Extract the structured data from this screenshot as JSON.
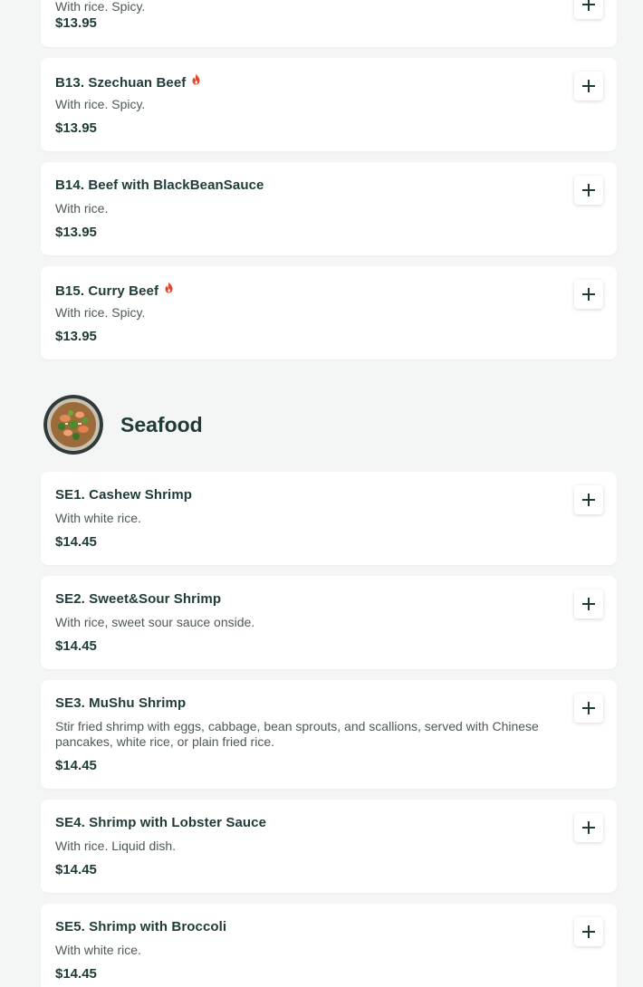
{
  "accent_color": "#1f3b38",
  "spicy_color": "#e0442b",
  "top_partial": {
    "description": "With rice. Spicy.",
    "price": "$13.95"
  },
  "beef_items": [
    {
      "title": "B13. Szechuan Beef",
      "spicy": true,
      "description": "With rice. Spicy.",
      "price": "$13.95"
    },
    {
      "title": "B14. Beef with BlackBeanSauce",
      "spicy": false,
      "description": "With rice.",
      "price": "$13.95"
    },
    {
      "title": "B15. Curry Beef",
      "spicy": true,
      "description": "With rice. Spicy.",
      "price": "$13.95"
    }
  ],
  "seafood": {
    "title": "Seafood",
    "image": "seafood-dish-photo",
    "items": [
      {
        "title": "SE1. Cashew Shrimp",
        "description": "With white rice.",
        "price": "$14.45"
      },
      {
        "title": "SE2. Sweet&Sour Shrimp",
        "description": "With rice, sweet sour sauce onside.",
        "price": "$14.45"
      },
      {
        "title": "SE3. MuShu Shrimp",
        "description": "Stir fried shrimp with eggs, cabbage, bean sprouts, and scallions, served with Chinese pancakes, white rice, or plain fried rice.",
        "price": "$14.45"
      },
      {
        "title": "SE4. Shrimp with Lobster Sauce",
        "description": "With rice. Liquid dish.",
        "price": "$14.45"
      },
      {
        "title": "SE5. Shrimp with Broccoli",
        "description": "With white rice.",
        "price": "$14.45"
      }
    ]
  },
  "icons": {
    "add": "plus-icon",
    "spicy": "flame-icon"
  }
}
